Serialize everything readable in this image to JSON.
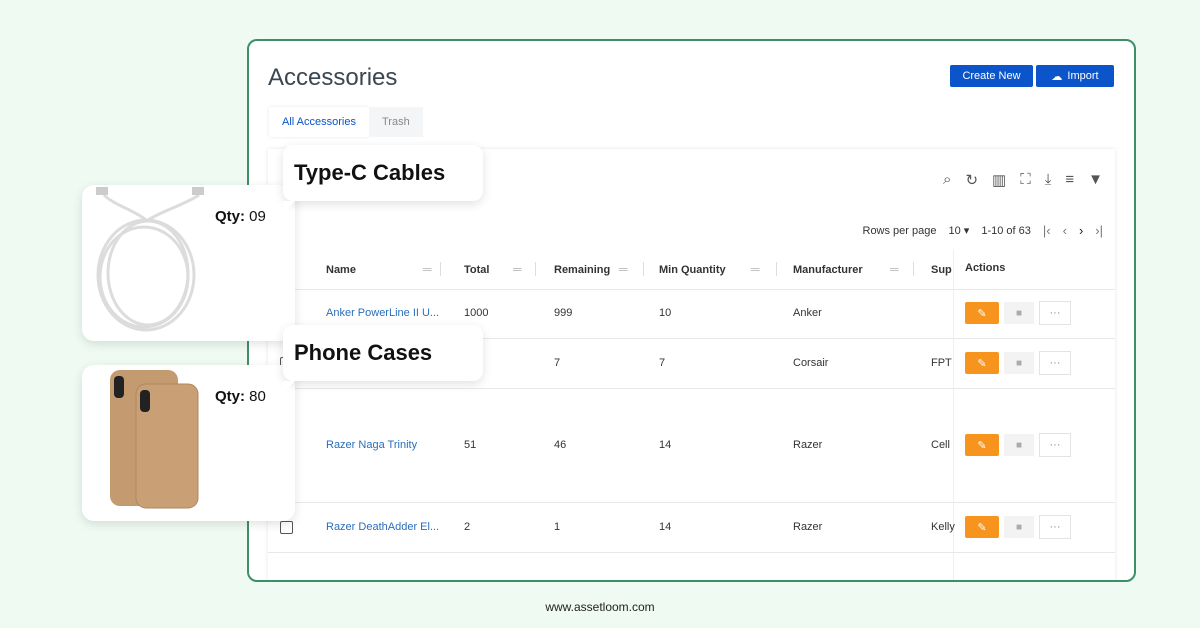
{
  "page": {
    "title": "Accessories",
    "create_label": "Create New",
    "import_label": "Import"
  },
  "tabs": [
    {
      "label": "All Accessories",
      "active": true
    },
    {
      "label": "Trash",
      "active": false
    }
  ],
  "toolbar_icons": [
    "search-icon",
    "refresh-icon",
    "columns-icon",
    "fullscreen-icon",
    "download-icon",
    "density-icon",
    "filter-icon"
  ],
  "pagination": {
    "rows_label": "Rows per page",
    "rows_value": "10",
    "range": "1-10 of 63"
  },
  "columns": [
    "Name",
    "Total",
    "Remaining",
    "Min Quantity",
    "Manufacturer",
    "Sup",
    "Actions"
  ],
  "rows": [
    {
      "name": "Anker PowerLine II U...",
      "total": "1000",
      "remaining": "999",
      "min": "10",
      "manufacturer": "Anker",
      "supplier": ""
    },
    {
      "name": "",
      "total": "",
      "remaining": "7",
      "min": "7",
      "manufacturer": "Corsair",
      "supplier": "FPT"
    },
    {
      "name": "Razer Naga Trinity",
      "total": "51",
      "remaining": "46",
      "min": "14",
      "manufacturer": "Razer",
      "supplier": "Cell"
    },
    {
      "name": "Razer DeathAdder El...",
      "total": "2",
      "remaining": "1",
      "min": "14",
      "manufacturer": "Razer",
      "supplier": "Kelly"
    }
  ],
  "callouts": [
    {
      "label": "Type-C Cables",
      "qty_label": "Qty:",
      "qty": "09"
    },
    {
      "label": "Phone Cases",
      "qty_label": "Qty:",
      "qty": "80"
    }
  ],
  "footer": "www.assetloom.com",
  "colors": {
    "primary": "#0b54c9",
    "edit": "#f7941d",
    "border": "#3d8f68",
    "background": "#eefaf2"
  }
}
